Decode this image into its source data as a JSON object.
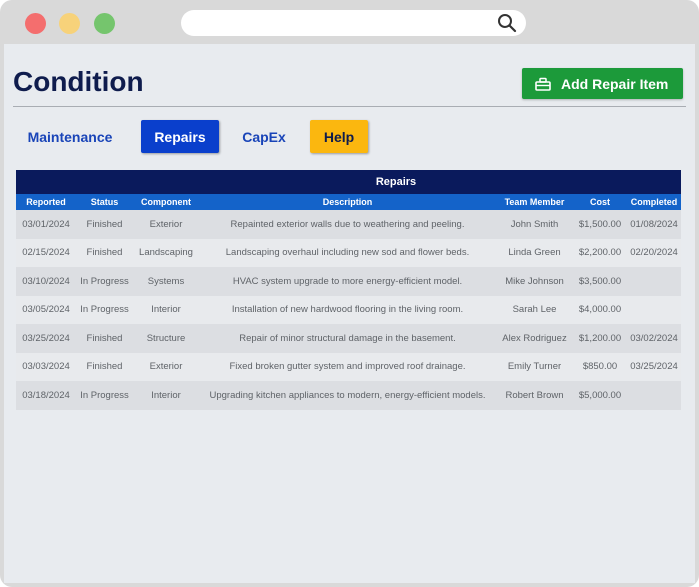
{
  "browser": {
    "address_value": ""
  },
  "header": {
    "title": "Condition",
    "add_button_label": "Add Repair Item"
  },
  "tabs": [
    {
      "label": "Maintenance"
    },
    {
      "label": "Repairs"
    },
    {
      "label": "CapEx"
    },
    {
      "label": "Help"
    }
  ],
  "table": {
    "title": "Repairs",
    "columns": [
      "Reported",
      "Status",
      "Component",
      "Description",
      "Team Member",
      "Cost",
      "Completed"
    ],
    "rows": [
      {
        "reported": "03/01/2024",
        "status": "Finished",
        "component": "Exterior",
        "description": "Repainted exterior walls due to weathering and peeling.",
        "member": "John Smith",
        "cost": "$1,500.00",
        "completed": "01/08/2024"
      },
      {
        "reported": "02/15/2024",
        "status": "Finished",
        "component": "Landscaping",
        "description": "Landscaping overhaul including new sod and flower beds.",
        "member": "Linda Green",
        "cost": "$2,200.00",
        "completed": "02/20/2024"
      },
      {
        "reported": "03/10/2024",
        "status": "In Progress",
        "component": "Systems",
        "description": "HVAC system upgrade to more energy-efficient model.",
        "member": "Mike Johnson",
        "cost": "$3,500.00",
        "completed": ""
      },
      {
        "reported": "03/05/2024",
        "status": "In Progress",
        "component": "Interior",
        "description": "Installation of new hardwood flooring in the living room.",
        "member": "Sarah Lee",
        "cost": "$4,000.00",
        "completed": ""
      },
      {
        "reported": "03/25/2024",
        "status": "Finished",
        "component": "Structure",
        "description": "Repair of minor structural damage in the basement.",
        "member": "Alex Rodriguez",
        "cost": "$1,200.00",
        "completed": "03/02/2024"
      },
      {
        "reported": "03/03/2024",
        "status": "Finished",
        "component": "Exterior",
        "description": "Fixed broken gutter system and improved roof drainage.",
        "member": "Emily Turner",
        "cost": "$850.00",
        "completed": "03/25/2024"
      },
      {
        "reported": "03/18/2024",
        "status": "In Progress",
        "component": "Interior",
        "description": "Upgrading kitchen appliances to modern, energy-efficient models.",
        "member": "Robert Brown",
        "cost": "$5,000.00",
        "completed": ""
      }
    ]
  },
  "icons": {
    "search": "search-icon",
    "add": "toolbox-icon"
  },
  "colors": {
    "accent_green": "#1c9a3a",
    "tab_active": "#0a3fcc",
    "help": "#fbb70f",
    "table_title": "#0a1a5c",
    "table_header": "#1463c9"
  }
}
